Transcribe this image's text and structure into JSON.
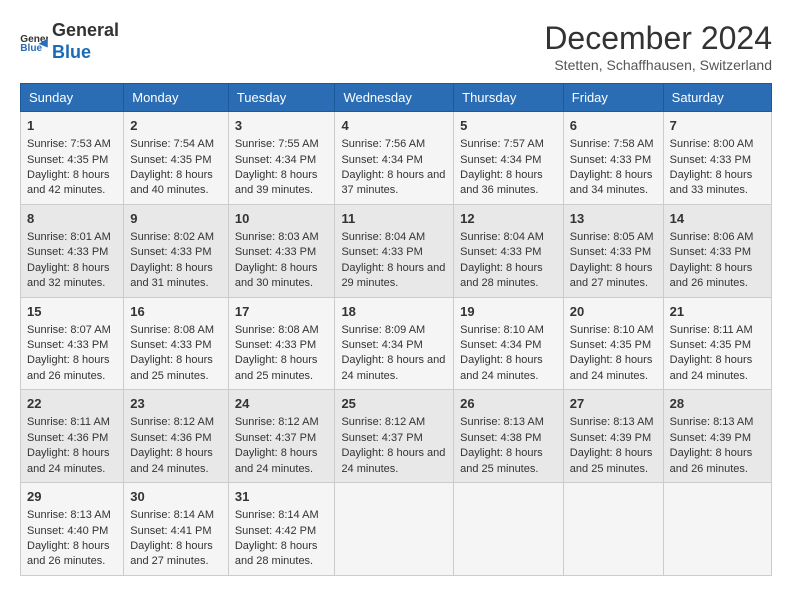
{
  "logo": {
    "line1": "General",
    "line2": "Blue"
  },
  "title": "December 2024",
  "subtitle": "Stetten, Schaffhausen, Switzerland",
  "days_header": [
    "Sunday",
    "Monday",
    "Tuesday",
    "Wednesday",
    "Thursday",
    "Friday",
    "Saturday"
  ],
  "weeks": [
    [
      {
        "day": "1",
        "sunrise": "Sunrise: 7:53 AM",
        "sunset": "Sunset: 4:35 PM",
        "daylight": "Daylight: 8 hours and 42 minutes."
      },
      {
        "day": "2",
        "sunrise": "Sunrise: 7:54 AM",
        "sunset": "Sunset: 4:35 PM",
        "daylight": "Daylight: 8 hours and 40 minutes."
      },
      {
        "day": "3",
        "sunrise": "Sunrise: 7:55 AM",
        "sunset": "Sunset: 4:34 PM",
        "daylight": "Daylight: 8 hours and 39 minutes."
      },
      {
        "day": "4",
        "sunrise": "Sunrise: 7:56 AM",
        "sunset": "Sunset: 4:34 PM",
        "daylight": "Daylight: 8 hours and 37 minutes."
      },
      {
        "day": "5",
        "sunrise": "Sunrise: 7:57 AM",
        "sunset": "Sunset: 4:34 PM",
        "daylight": "Daylight: 8 hours and 36 minutes."
      },
      {
        "day": "6",
        "sunrise": "Sunrise: 7:58 AM",
        "sunset": "Sunset: 4:33 PM",
        "daylight": "Daylight: 8 hours and 34 minutes."
      },
      {
        "day": "7",
        "sunrise": "Sunrise: 8:00 AM",
        "sunset": "Sunset: 4:33 PM",
        "daylight": "Daylight: 8 hours and 33 minutes."
      }
    ],
    [
      {
        "day": "8",
        "sunrise": "Sunrise: 8:01 AM",
        "sunset": "Sunset: 4:33 PM",
        "daylight": "Daylight: 8 hours and 32 minutes."
      },
      {
        "day": "9",
        "sunrise": "Sunrise: 8:02 AM",
        "sunset": "Sunset: 4:33 PM",
        "daylight": "Daylight: 8 hours and 31 minutes."
      },
      {
        "day": "10",
        "sunrise": "Sunrise: 8:03 AM",
        "sunset": "Sunset: 4:33 PM",
        "daylight": "Daylight: 8 hours and 30 minutes."
      },
      {
        "day": "11",
        "sunrise": "Sunrise: 8:04 AM",
        "sunset": "Sunset: 4:33 PM",
        "daylight": "Daylight: 8 hours and 29 minutes."
      },
      {
        "day": "12",
        "sunrise": "Sunrise: 8:04 AM",
        "sunset": "Sunset: 4:33 PM",
        "daylight": "Daylight: 8 hours and 28 minutes."
      },
      {
        "day": "13",
        "sunrise": "Sunrise: 8:05 AM",
        "sunset": "Sunset: 4:33 PM",
        "daylight": "Daylight: 8 hours and 27 minutes."
      },
      {
        "day": "14",
        "sunrise": "Sunrise: 8:06 AM",
        "sunset": "Sunset: 4:33 PM",
        "daylight": "Daylight: 8 hours and 26 minutes."
      }
    ],
    [
      {
        "day": "15",
        "sunrise": "Sunrise: 8:07 AM",
        "sunset": "Sunset: 4:33 PM",
        "daylight": "Daylight: 8 hours and 26 minutes."
      },
      {
        "day": "16",
        "sunrise": "Sunrise: 8:08 AM",
        "sunset": "Sunset: 4:33 PM",
        "daylight": "Daylight: 8 hours and 25 minutes."
      },
      {
        "day": "17",
        "sunrise": "Sunrise: 8:08 AM",
        "sunset": "Sunset: 4:33 PM",
        "daylight": "Daylight: 8 hours and 25 minutes."
      },
      {
        "day": "18",
        "sunrise": "Sunrise: 8:09 AM",
        "sunset": "Sunset: 4:34 PM",
        "daylight": "Daylight: 8 hours and 24 minutes."
      },
      {
        "day": "19",
        "sunrise": "Sunrise: 8:10 AM",
        "sunset": "Sunset: 4:34 PM",
        "daylight": "Daylight: 8 hours and 24 minutes."
      },
      {
        "day": "20",
        "sunrise": "Sunrise: 8:10 AM",
        "sunset": "Sunset: 4:35 PM",
        "daylight": "Daylight: 8 hours and 24 minutes."
      },
      {
        "day": "21",
        "sunrise": "Sunrise: 8:11 AM",
        "sunset": "Sunset: 4:35 PM",
        "daylight": "Daylight: 8 hours and 24 minutes."
      }
    ],
    [
      {
        "day": "22",
        "sunrise": "Sunrise: 8:11 AM",
        "sunset": "Sunset: 4:36 PM",
        "daylight": "Daylight: 8 hours and 24 minutes."
      },
      {
        "day": "23",
        "sunrise": "Sunrise: 8:12 AM",
        "sunset": "Sunset: 4:36 PM",
        "daylight": "Daylight: 8 hours and 24 minutes."
      },
      {
        "day": "24",
        "sunrise": "Sunrise: 8:12 AM",
        "sunset": "Sunset: 4:37 PM",
        "daylight": "Daylight: 8 hours and 24 minutes."
      },
      {
        "day": "25",
        "sunrise": "Sunrise: 8:12 AM",
        "sunset": "Sunset: 4:37 PM",
        "daylight": "Daylight: 8 hours and 24 minutes."
      },
      {
        "day": "26",
        "sunrise": "Sunrise: 8:13 AM",
        "sunset": "Sunset: 4:38 PM",
        "daylight": "Daylight: 8 hours and 25 minutes."
      },
      {
        "day": "27",
        "sunrise": "Sunrise: 8:13 AM",
        "sunset": "Sunset: 4:39 PM",
        "daylight": "Daylight: 8 hours and 25 minutes."
      },
      {
        "day": "28",
        "sunrise": "Sunrise: 8:13 AM",
        "sunset": "Sunset: 4:39 PM",
        "daylight": "Daylight: 8 hours and 26 minutes."
      }
    ],
    [
      {
        "day": "29",
        "sunrise": "Sunrise: 8:13 AM",
        "sunset": "Sunset: 4:40 PM",
        "daylight": "Daylight: 8 hours and 26 minutes."
      },
      {
        "day": "30",
        "sunrise": "Sunrise: 8:14 AM",
        "sunset": "Sunset: 4:41 PM",
        "daylight": "Daylight: 8 hours and 27 minutes."
      },
      {
        "day": "31",
        "sunrise": "Sunrise: 8:14 AM",
        "sunset": "Sunset: 4:42 PM",
        "daylight": "Daylight: 8 hours and 28 minutes."
      },
      null,
      null,
      null,
      null
    ]
  ]
}
